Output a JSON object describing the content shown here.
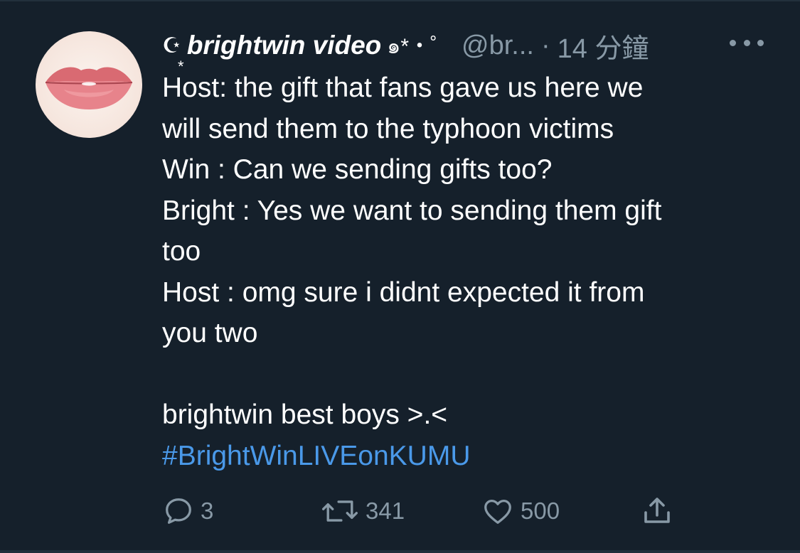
{
  "tweet": {
    "author": {
      "name_prefix": "☪︎",
      "name_prefix_under": "*",
      "display_name": "brightwin video",
      "name_suffix": "๑*・゜",
      "handle": "@br...",
      "separator": "·",
      "timestamp": "14 分鐘"
    },
    "lines": [
      "Host: the gift that fans gave us here we",
      "will send them to the typhoon victims",
      "Win : Can we sending gifts too?",
      "Bright : Yes we want to sending them gift",
      "too",
      "Host : omg sure i didnt expected it from",
      "you two",
      "",
      "brightwin best boys >.<"
    ],
    "hashtag": "#BrightWinLIVEonKUMU",
    "actions": {
      "replies": "3",
      "retweets": "341",
      "likes": "500"
    }
  },
  "colors": {
    "background": "#15202b",
    "text": "#ffffff",
    "secondary": "#8899a6",
    "link": "#4a99e9"
  },
  "icons": [
    "reply-icon",
    "retweet-icon",
    "like-icon",
    "share-icon",
    "more-icon"
  ]
}
